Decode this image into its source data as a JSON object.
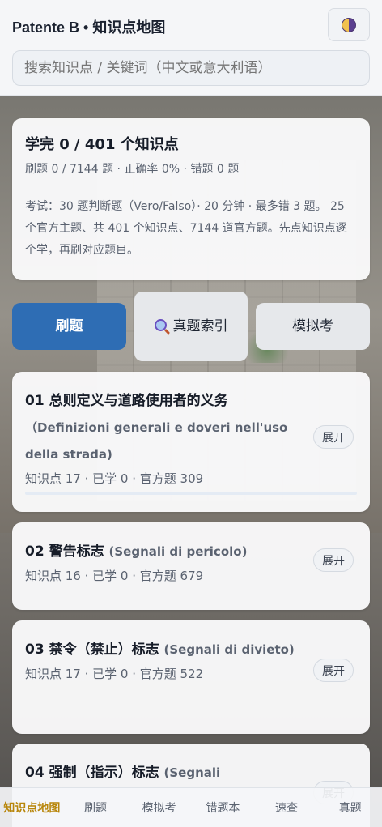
{
  "header": {
    "title": "Patente B • 知识点地图",
    "theme_icon": "theme-toggle-icon",
    "search_placeholder": "搜索知识点 / 关键词（中文或意大利语）"
  },
  "summary": {
    "headline": "学完 0 / 401 个知识点",
    "stats": "刷题 0 / 7144 题 · 正确率 0% · 错题 0 题",
    "description": "考试：30 题判断题（Vero/Falso）· 20 分钟 · 最多错 3 题。 25 个官方主题、共 401 个知识点、7144 道官方题。先点知识点逐个学，再刷对应题目。"
  },
  "actions": {
    "practice": "刷题",
    "index": "真题索引",
    "index_icon": "magnifier-icon",
    "mock": "模拟考"
  },
  "chapters": [
    {
      "title": "01 总则定义与道路使用者的义务",
      "italian": "（Definizioni generali e doveri nell'uso della strada)",
      "meta": "知识点 17 · 已学 0 · 官方题 309",
      "expand": "展开",
      "progress": 0
    },
    {
      "title": "02 警告标志",
      "italian": "(Segnali di pericolo)",
      "meta": "知识点 16 · 已学 0 · 官方题 679",
      "expand": "展开",
      "progress": 0
    },
    {
      "title": "03 禁令（禁止）标志",
      "italian": "(Segnali di divieto)",
      "meta": "知识点 17 · 已学 0 · 官方题 522",
      "expand": "展开",
      "progress": 0
    },
    {
      "title": "04 强制（指示）标志",
      "italian": "(Segnali",
      "meta": "",
      "expand": "展开",
      "progress": 0
    }
  ],
  "bottom_nav": [
    {
      "label": "知识点地图",
      "active": true
    },
    {
      "label": "刷题",
      "active": false
    },
    {
      "label": "模拟考",
      "active": false
    },
    {
      "label": "错题本",
      "active": false
    },
    {
      "label": "速查",
      "active": false
    },
    {
      "label": "真题",
      "active": false
    }
  ],
  "colors": {
    "primary": "#2e6db4",
    "active_nav": "#b8860b"
  }
}
